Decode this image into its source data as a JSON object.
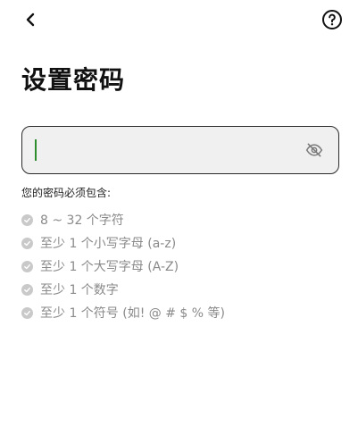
{
  "header": {
    "back_icon": "chevron-left-icon",
    "help_icon": "question-circle-icon"
  },
  "page": {
    "title": "设置密码"
  },
  "password_field": {
    "value": "",
    "placeholder": "",
    "visibility_icon": "eye-off-icon"
  },
  "requirements": {
    "heading": "您的密码必须包含:",
    "items": [
      {
        "label": "8 ~ 32 个字符"
      },
      {
        "label": "至少 1 个小写字母 (a-z)"
      },
      {
        "label": "至少 1 个大写字母 (A-Z)"
      },
      {
        "label": "至少 1 个数字"
      },
      {
        "label": "至少 1 个符号 (如! @ # $ % 等)"
      }
    ]
  },
  "colors": {
    "caret": "#2e8b2e",
    "field_background": "#f0f0f0",
    "requirement_text": "#8a8a8a",
    "requirement_check": "#c9c9c9"
  }
}
